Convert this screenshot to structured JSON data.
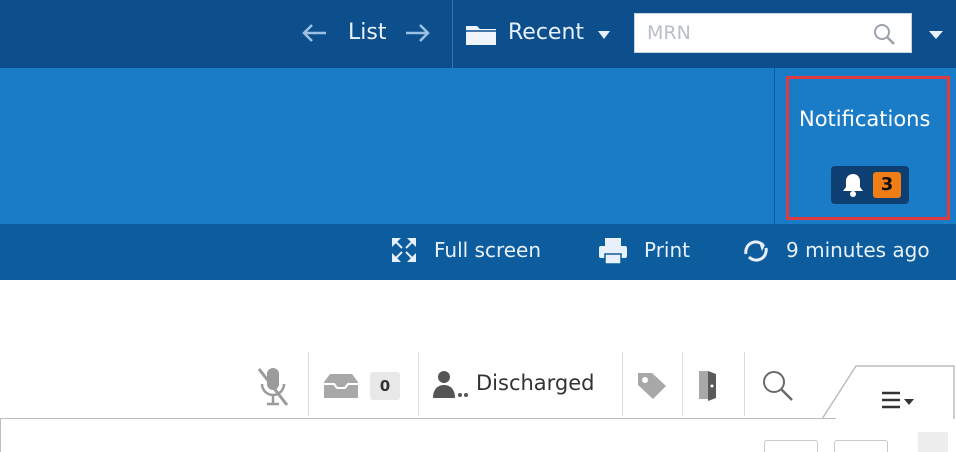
{
  "header": {
    "list_label": "List",
    "recent_label": "Recent",
    "mrn_placeholder": "MRN"
  },
  "notifications": {
    "title": "Notifications",
    "count": "3"
  },
  "subbar": {
    "fullscreen_label": "Full screen",
    "print_label": "Print",
    "refresh_label": "9 minutes ago"
  },
  "toolbar": {
    "inbox_count": "0",
    "status_label": "Discharged"
  },
  "colors": {
    "top_bar": "#0d4f8c",
    "band": "#1a7cc7",
    "subbar": "#0d5c9e",
    "notif_border": "#e03a43",
    "badge": "#f07d16"
  }
}
